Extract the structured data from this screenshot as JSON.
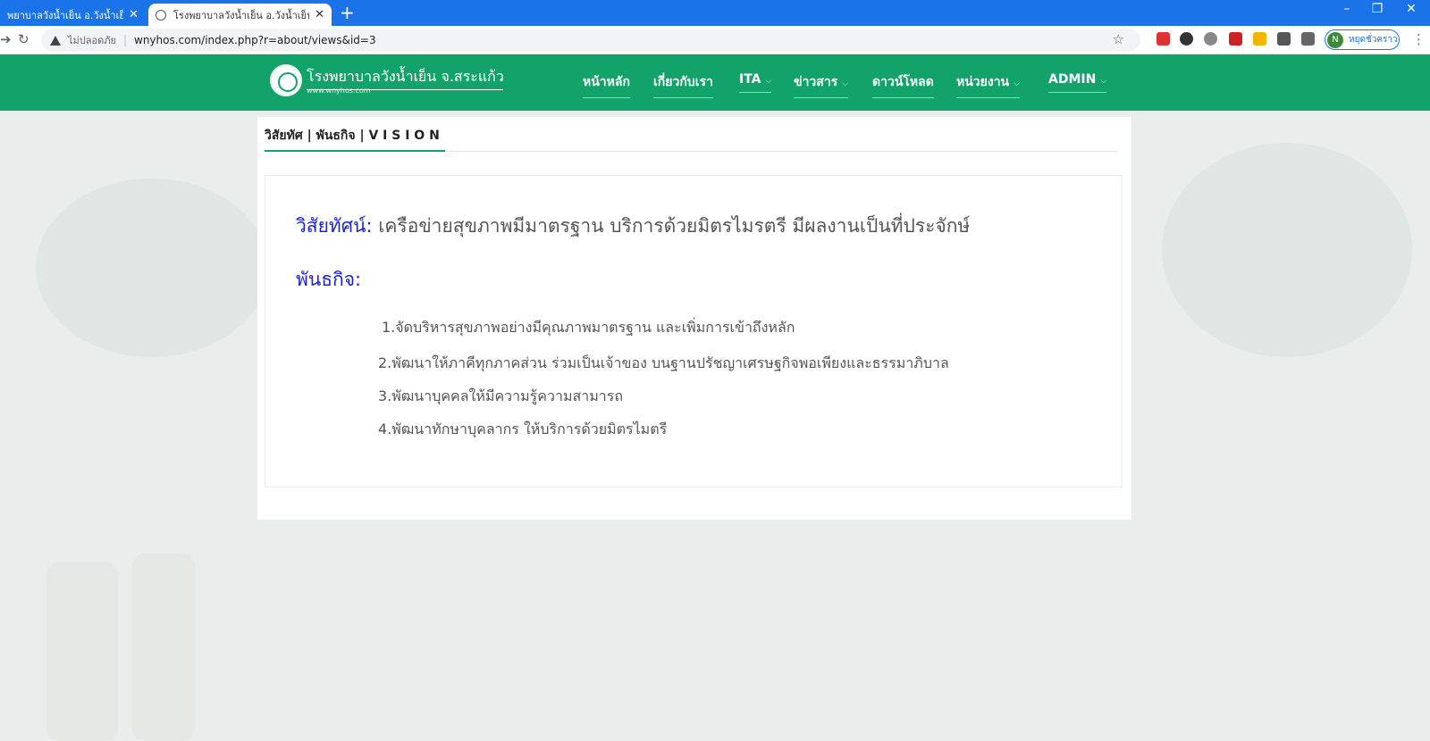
{
  "browser": {
    "tabs": [
      {
        "title": "พยาบาลวังน้ำเย็น อ.วังน้ำเย็น จ.สระแ",
        "active": false
      },
      {
        "title": "โรงพยาบาลวังน้ำเย็น อ.วังน้ำเย็น จ.สระแ",
        "active": true
      }
    ],
    "new_tab": "+",
    "window_controls": {
      "minimize": "–",
      "restore": "❐",
      "close": "✕"
    },
    "toolbar": {
      "back_icon": "arrow-right-icon",
      "reload_icon": "reload-icon",
      "security_label": "ไม่ปลอดภัย",
      "separator": "|",
      "url": "wnyhos.com/index.php?r=about/views&id=3",
      "profile_initial": "N",
      "profile_label": "หยุดชั่วคราว"
    }
  },
  "site": {
    "brand_name": "โรงพยาบาลวังน้ำเย็น จ.สระแก้ว",
    "brand_sub": "www.wnyhos.com",
    "nav": [
      {
        "label": "หน้าหลัก",
        "chevron": false
      },
      {
        "label": "เกี่ยวกับเรา",
        "chevron": false
      },
      {
        "label": "ITA",
        "chevron": true
      },
      {
        "label": "ข่าวสาร",
        "chevron": true
      },
      {
        "label": "ดาวน์โหลด",
        "chevron": false
      },
      {
        "label": "หน่วยงาน",
        "chevron": true
      },
      {
        "label": "ADMIN",
        "chevron": true
      }
    ],
    "colors": {
      "header": "#12a36a",
      "heading_blue": "#1b22d6",
      "browser_blue": "#1a73e8"
    }
  },
  "content": {
    "page_title": "วิสัยทัศ | พันธกิจ | V I S I O N",
    "vision_label": "วิสัยทัศน์:",
    "vision_text": " เครือข่ายสุขภาพมีมาตรฐาน  บริการด้วยมิตรไมรตรี มีผลงานเป็นที่ประจักษ์",
    "mission_label": "พันธกิจ:",
    "missions": [
      "1.จัดบริหารสุขภาพอย่างมีคุณภาพมาตรฐาน และเพิ่มการเข้าถึงหลัก",
      "2.พัฒนาให้ภาคีทุกภาคส่วน ร่วมเป็นเจ้าของ บนฐานปรัชญาเศรษฐกิจพอเพียงและธรรมาภิบาล",
      "3.พัฒนาบุคคลให้มีความรู้ความสามารถ",
      "4.พัฒนาทักษาบุคลากร ให้บริการด้วยมิตรไมตรี"
    ]
  }
}
